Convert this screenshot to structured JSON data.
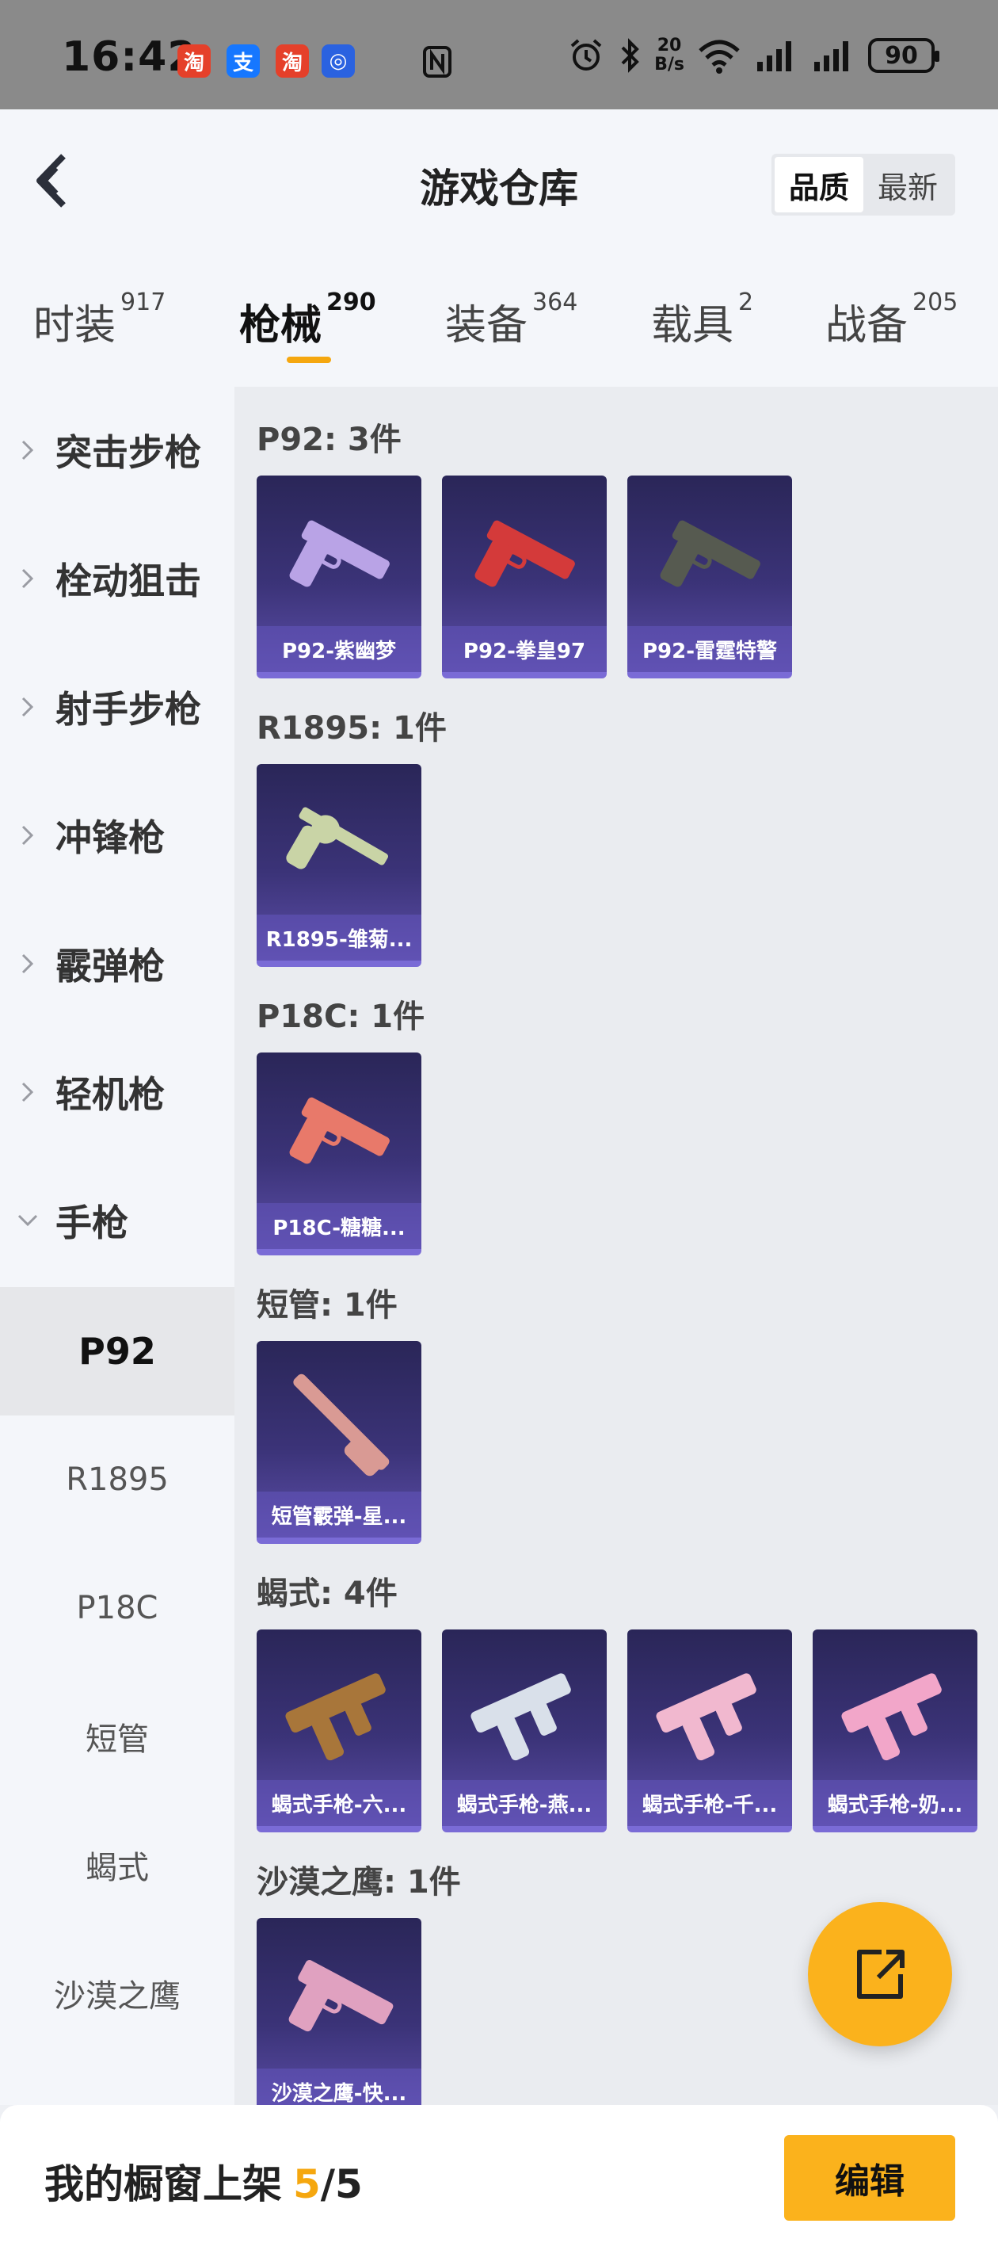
{
  "status_bar": {
    "time": "16:42",
    "apps": [
      {
        "icon": "taobao-icon",
        "glyph": "淘",
        "color": "#e5402a"
      },
      {
        "icon": "alipay-icon",
        "glyph": "支",
        "color": "#1677ff"
      },
      {
        "icon": "taobao-icon",
        "glyph": "淘",
        "color": "#e5402a"
      },
      {
        "icon": "app-icon",
        "glyph": "◎",
        "color": "#2a62e0"
      }
    ],
    "net_speed_value": "20",
    "net_speed_unit": "B/s",
    "battery": "90"
  },
  "header": {
    "title": "游戏仓库",
    "sort_options": [
      "品质",
      "最新"
    ],
    "active_sort": "品质"
  },
  "tabs": [
    {
      "label": "时装",
      "count": "917"
    },
    {
      "label": "枪械",
      "count": "290"
    },
    {
      "label": "装备",
      "count": "364"
    },
    {
      "label": "载具",
      "count": "2"
    },
    {
      "label": "战备",
      "count": "205"
    }
  ],
  "active_tab": "枪械",
  "sidebar": {
    "categories": [
      "突击步枪",
      "栓动狙击",
      "射手步枪",
      "冲锋枪",
      "霰弹枪",
      "轻机枪",
      "手枪"
    ],
    "expanded_category": "手枪",
    "sub_items": [
      "P92",
      "R1895",
      "P18C",
      "短管",
      "蝎式",
      "沙漠之鹰"
    ],
    "active_sub_item": "P92"
  },
  "groups": [
    {
      "title": "P92: 3件",
      "items": [
        "P92-紫幽梦",
        "P92-拳皇97",
        "P92-雷霆特警"
      ],
      "colors": [
        "#b9a3e6",
        "#d43a3a",
        "#565a50"
      ]
    },
    {
      "title": "R1895: 1件",
      "items": [
        "R1895-雏菊..."
      ],
      "colors": [
        "#c9d4a6"
      ]
    },
    {
      "title": "P18C: 1件",
      "items": [
        "P18C-糖糖..."
      ],
      "colors": [
        "#e8796a"
      ]
    },
    {
      "title": "短管: 1件",
      "items": [
        "短管霰弹-星..."
      ],
      "colors": [
        "#d99a94"
      ]
    },
    {
      "title": "蝎式: 4件",
      "items": [
        "蝎式手枪-六...",
        "蝎式手枪-燕...",
        "蝎式手枪-千...",
        "蝎式手枪-奶..."
      ],
      "colors": [
        "#a8763a",
        "#d9e0ea",
        "#f1b8cf",
        "#f2a6c9"
      ]
    },
    {
      "title": "沙漠之鹰: 1件",
      "items": [
        "沙漠之鹰-快..."
      ],
      "colors": [
        "#e0a1c0"
      ]
    }
  ],
  "bottom_bar": {
    "label": "我的橱窗上架",
    "used": "5",
    "total": "/5",
    "edit_label": "编辑"
  }
}
